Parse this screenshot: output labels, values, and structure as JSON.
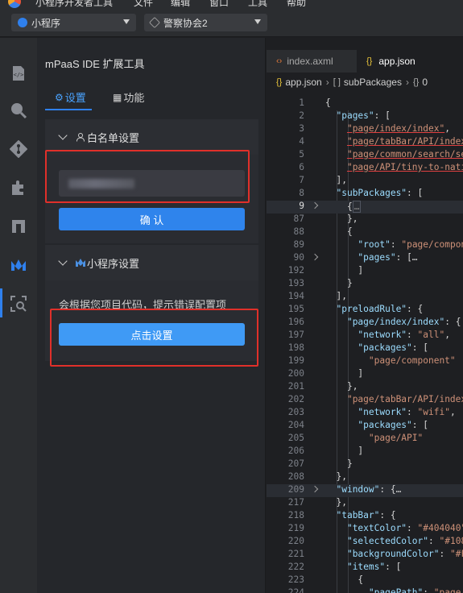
{
  "menu": {
    "items": [
      "小程序开发者工具",
      "文件",
      "编辑",
      "窗口",
      "工具",
      "帮助"
    ]
  },
  "toolbar": {
    "project_type": "小程序",
    "project_name": "警察协会2"
  },
  "activity_bar": {
    "icons": [
      "code-icon",
      "search-icon",
      "git-icon",
      "extensions-icon",
      "layout-icon",
      "mpaas-icon",
      "scan-icon"
    ],
    "active": "mpaas-icon"
  },
  "panel": {
    "title": "mPaaS IDE 扩展工具",
    "tabs": [
      {
        "label": "设置",
        "icon": "⚙",
        "active": true
      },
      {
        "label": "功能",
        "icon": "▦",
        "active": false
      }
    ],
    "whitelist": {
      "title": "白名单设置",
      "input_value": "",
      "confirm_label": "确 认"
    },
    "miniprogram": {
      "title": "小程序设置",
      "hint": "会根据您项目代码，提示错误配置项",
      "button_label": "点击设置"
    }
  },
  "editor": {
    "tabs": [
      {
        "label": "index.axml",
        "icon": "‹›",
        "active": false
      },
      {
        "label": "app.json",
        "icon": "{}",
        "active": true
      }
    ],
    "breadcrumb": [
      "app.json",
      "subPackages",
      "0"
    ],
    "lines": [
      {
        "n": "1",
        "t": "{"
      },
      {
        "n": "2",
        "t": "  \"pages\": ["
      },
      {
        "n": "3",
        "t": "    \"page/index/index\","
      },
      {
        "n": "4",
        "t": "    \"page/tabBar/API/index"
      },
      {
        "n": "5",
        "t": "    \"page/common/search/se"
      },
      {
        "n": "6",
        "t": "    \"page/API/tiny-to-nati"
      },
      {
        "n": "7",
        "t": "  ],"
      },
      {
        "n": "8",
        "t": "  \"subPackages\": ["
      },
      {
        "n": "9",
        "t": "    {…"
      },
      {
        "n": "87",
        "t": "    },"
      },
      {
        "n": "88",
        "t": "    {"
      },
      {
        "n": "89",
        "t": "      \"root\": \"page/compon"
      },
      {
        "n": "90",
        "t": "      \"pages\": […"
      },
      {
        "n": "192",
        "t": "      ]"
      },
      {
        "n": "193",
        "t": "    }"
      },
      {
        "n": "194",
        "t": "  ],"
      },
      {
        "n": "195",
        "t": "  \"preloadRule\": {"
      },
      {
        "n": "196",
        "t": "    \"page/index/index\": {"
      },
      {
        "n": "197",
        "t": "      \"network\": \"all\","
      },
      {
        "n": "198",
        "t": "      \"packages\": ["
      },
      {
        "n": "199",
        "t": "        \"page/component\""
      },
      {
        "n": "200",
        "t": "      ]"
      },
      {
        "n": "201",
        "t": "    },"
      },
      {
        "n": "202",
        "t": "    \"page/tabBar/API/index"
      },
      {
        "n": "203",
        "t": "      \"network\": \"wifi\","
      },
      {
        "n": "204",
        "t": "      \"packages\": ["
      },
      {
        "n": "205",
        "t": "        \"page/API\""
      },
      {
        "n": "206",
        "t": "      ]"
      },
      {
        "n": "207",
        "t": "    }"
      },
      {
        "n": "208",
        "t": "  },"
      },
      {
        "n": "209",
        "t": "  \"window\": {…"
      },
      {
        "n": "217",
        "t": "  },"
      },
      {
        "n": "218",
        "t": "  \"tabBar\": {"
      },
      {
        "n": "219",
        "t": "    \"textColor\": \"#404040\""
      },
      {
        "n": "220",
        "t": "    \"selectedColor\": \"#108"
      },
      {
        "n": "221",
        "t": "    \"backgroundColor\": \"#F"
      },
      {
        "n": "222",
        "t": "    \"items\": ["
      },
      {
        "n": "223",
        "t": "      {"
      },
      {
        "n": "224",
        "t": "        \"pagePath\": \"page/"
      }
    ]
  },
  "colors": {
    "accent": "#2f80ed",
    "highlight_box": "#e0302a",
    "string": "#ce9178",
    "key": "#9cdcfe"
  }
}
